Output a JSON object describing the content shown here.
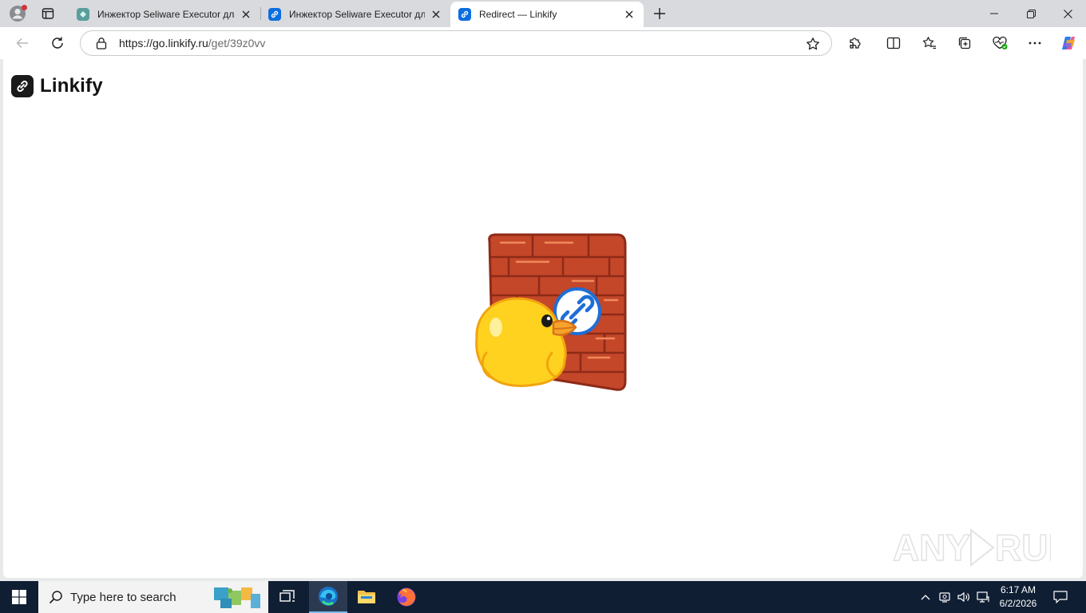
{
  "browser": {
    "tabs": [
      {
        "title": "Инжектор Seliware Executor для",
        "state": "inactive",
        "favicon": "seliware-favicon"
      },
      {
        "title": "Инжектор Seliware Executor для",
        "state": "inactive",
        "favicon": "linkify-favicon"
      },
      {
        "title": "Redirect — Linkify",
        "state": "active",
        "favicon": "linkify-favicon"
      }
    ],
    "address": {
      "url_host": "https://go.linkify.ru",
      "url_path": "/get/39z0vv"
    }
  },
  "page": {
    "brand_name": "Linkify",
    "illustration": "duck-at-brick-wall-with-link-sign"
  },
  "watermark": {
    "text": "ANY RUN"
  },
  "taskbar": {
    "search_placeholder": "Type here to search",
    "time": "6:17 AM",
    "date": "6/2/2026"
  },
  "colors": {
    "accent": "#0078d4",
    "brick": "#c4472a",
    "duck": "#ffd21f",
    "taskbar": "#0f1e33"
  }
}
